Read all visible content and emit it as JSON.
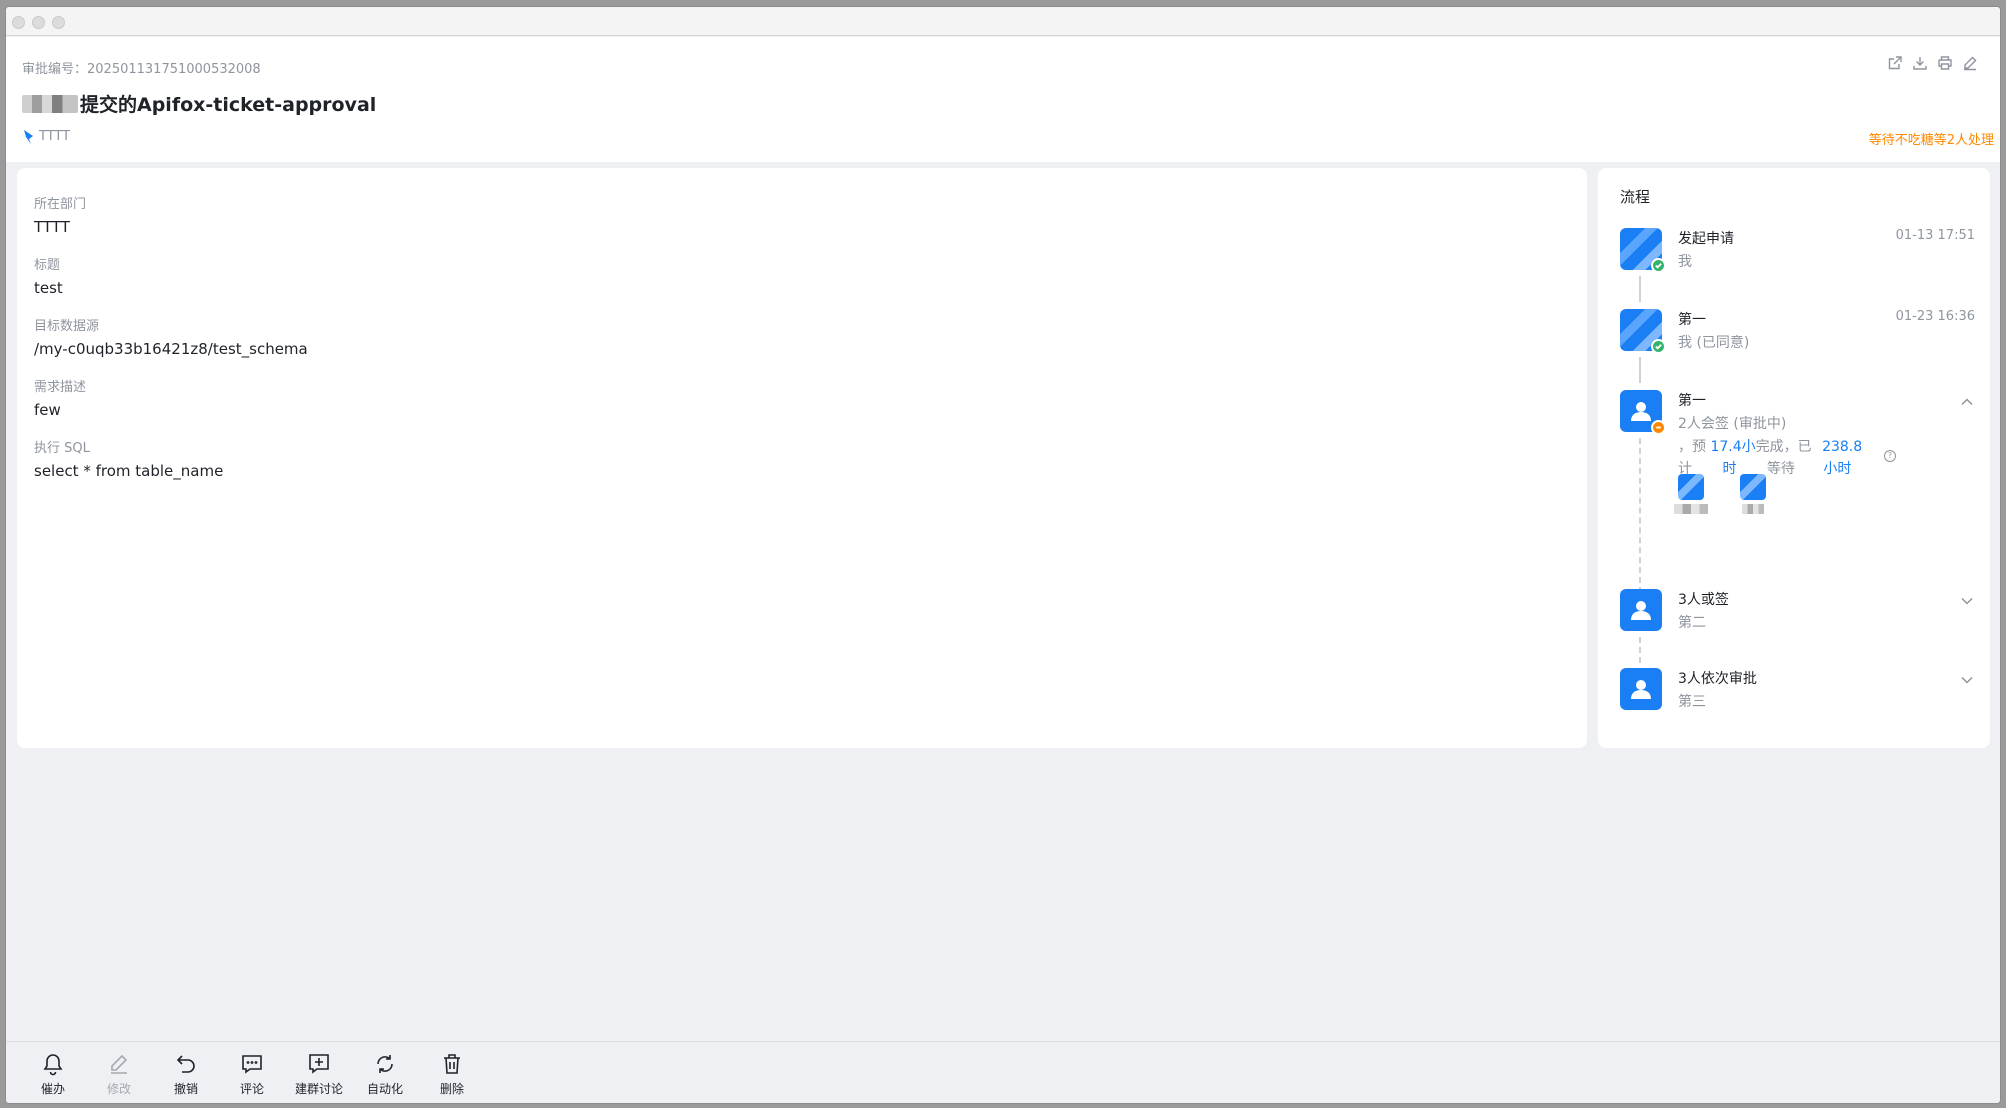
{
  "header": {
    "approval_no": "审批编号：202501131751000532008",
    "title": "提交的Apifox-ticket-approval",
    "department": "TTTT",
    "status": "等待不吃糖等2人处理"
  },
  "form": {
    "fields": [
      {
        "label": "所在部门",
        "value": "TTTT"
      },
      {
        "label": "标题",
        "value": "test"
      },
      {
        "label": "目标数据源",
        "value": "/my-c0uqb33b16421z8/test_schema"
      },
      {
        "label": "需求描述",
        "value": "few"
      },
      {
        "label": "执行 SQL",
        "value": "select * from table_name"
      }
    ]
  },
  "flow": {
    "title": "流程",
    "nodes": [
      {
        "name": "发起申请",
        "sub": "我",
        "time": "01-13 17:51"
      },
      {
        "name": "第一",
        "sub": "我 (已同意)",
        "time": "01-23 16:36"
      },
      {
        "name": "第一",
        "sub": "2人会签 (审批中)",
        "est_line1_a": "，预",
        "est_line1_b": "17.4小",
        "est_line1_c": "完成，已",
        "est_line1_d": "238.8",
        "est_line2_a": "计",
        "est_line2_b": "时",
        "est_line2_c": "等待",
        "est_line2_d": "小时"
      },
      {
        "name": "3人或签",
        "sub": "第二"
      },
      {
        "name": "3人依次审批",
        "sub": "第三"
      }
    ]
  },
  "toolbar": {
    "remind": "催办",
    "edit": "修改",
    "revoke": "撤销",
    "comment": "评论",
    "group": "建群讨论",
    "automation": "自动化",
    "delete": "删除"
  },
  "icons": {
    "share": "share-icon",
    "download": "download-icon",
    "print": "print-icon",
    "edit": "edit-icon"
  },
  "colors": {
    "accent": "#1a7ef5",
    "status": "#ff8800",
    "success": "#34b36b"
  }
}
